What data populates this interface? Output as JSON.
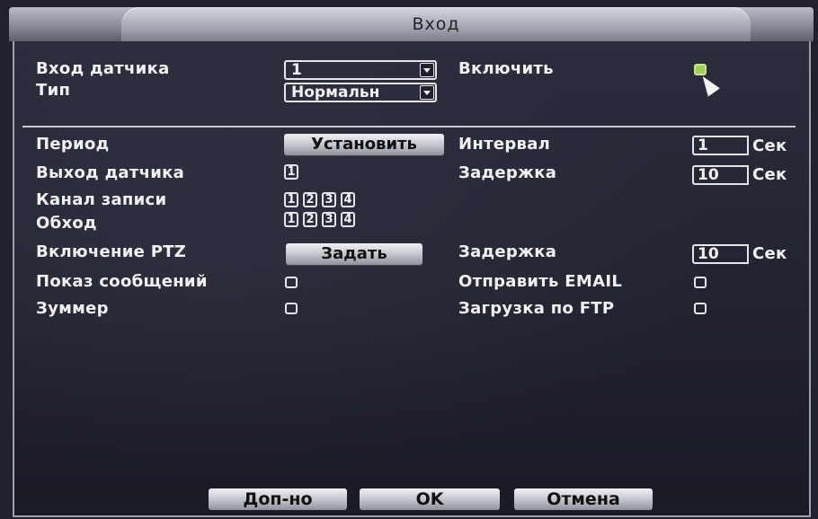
{
  "window": {
    "title": "Вход"
  },
  "fields": {
    "sensor_input": {
      "label": "Вход датчика",
      "value": "1"
    },
    "enable": {
      "label": "Включить",
      "checked": true
    },
    "type": {
      "label": "Тип",
      "value": "Нормальн"
    },
    "period": {
      "label": "Период",
      "button": "Установить"
    },
    "interval": {
      "label": "Интервал",
      "value": "1",
      "unit": "Сек"
    },
    "sensor_output": {
      "label": "Выход датчика",
      "channels": [
        "1"
      ]
    },
    "delay1": {
      "label": "Задержка",
      "value": "10",
      "unit": "Сек"
    },
    "record_channel": {
      "label": "Канал записи",
      "channels": [
        "1",
        "2",
        "3",
        "4"
      ]
    },
    "tour": {
      "label": "Обход",
      "channels": [
        "1",
        "2",
        "3",
        "4"
      ]
    },
    "ptz": {
      "label": "Включение PTZ",
      "button": "Задать"
    },
    "delay2": {
      "label": "Задержка",
      "value": "10",
      "unit": "Сек"
    },
    "show_message": {
      "label": "Показ сообщений",
      "checked": false
    },
    "send_email": {
      "label": "Отправить EMAIL",
      "checked": false
    },
    "buzzer": {
      "label": "Зуммер",
      "checked": false
    },
    "ftp_upload": {
      "label": "Загрузка по FTP",
      "checked": false
    }
  },
  "footer": {
    "advanced": "Доп-но",
    "ok": "OK",
    "cancel": "Отмена"
  },
  "colors": {
    "check_on": "#9fd15a",
    "panel_bg": "#20212c"
  }
}
